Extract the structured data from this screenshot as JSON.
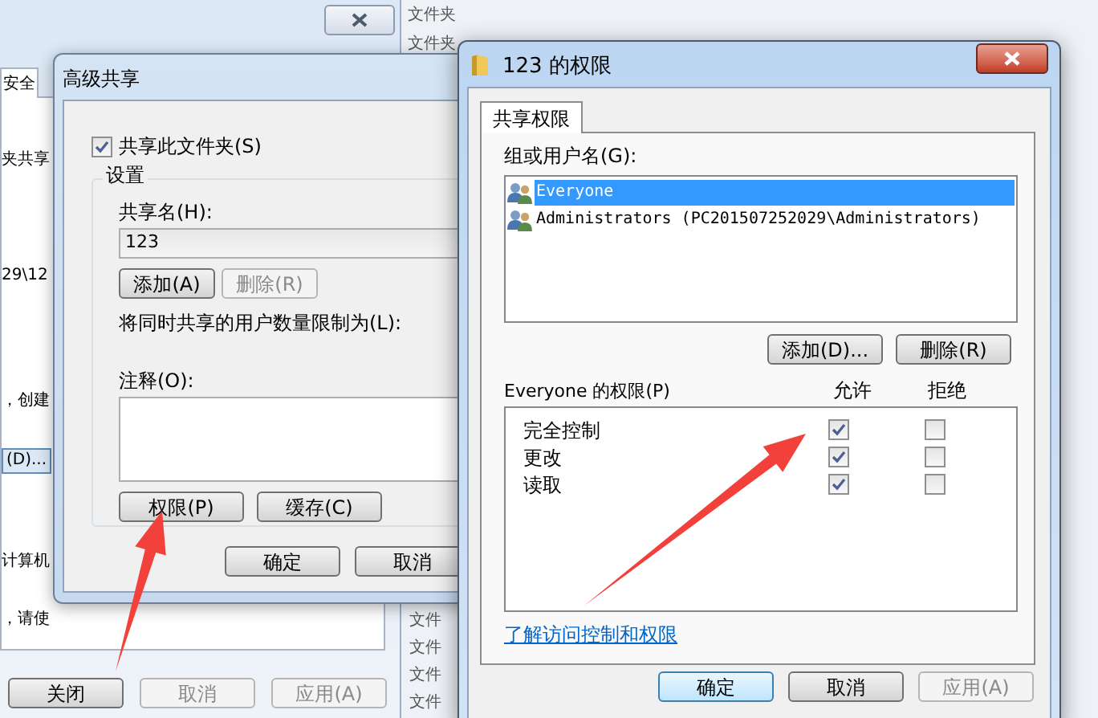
{
  "background_window": {
    "tab": "安全",
    "fragments": [
      {
        "kind": "text",
        "text": "夹共享"
      },
      {
        "kind": "text",
        "text": "29\\12"
      },
      {
        "kind": "text",
        "text": "，创建"
      },
      {
        "kind": "button",
        "text": "(D)..."
      },
      {
        "kind": "text",
        "text": "计算机"
      },
      {
        "kind": "text",
        "text": "，请使"
      }
    ],
    "buttons": [
      {
        "label": "关闭",
        "disabled": false
      },
      {
        "label": "取消",
        "disabled": true
      },
      {
        "label": "应用(A)",
        "disabled": true
      }
    ],
    "side_labels_top": [
      "文件夹",
      "文件夹"
    ],
    "side_labels_bottom": [
      "文件",
      "文件",
      "文件",
      "文件"
    ]
  },
  "advanced_sharing": {
    "title": "高级共享",
    "share_checkbox": {
      "label": "共享此文件夹(S)",
      "checked": true
    },
    "group_title": "设置",
    "share_name_label": "共享名(H):",
    "share_name": "123",
    "add_button": {
      "label": "添加(A)",
      "disabled": false
    },
    "remove_button": {
      "label": "删除(R)",
      "disabled": true
    },
    "limit_label": "将同时共享的用户数量限制为(L):",
    "comment_label": "注释(O):",
    "buttons": [
      {
        "label": "权限(P)"
      },
      {
        "label": "缓存(C)"
      }
    ],
    "footer_buttons": [
      {
        "label": "确定"
      },
      {
        "label": "取消"
      }
    ]
  },
  "permissions_dialog": {
    "title": "123 的权限",
    "tabs": [
      {
        "label": "共享权限",
        "selected": true
      }
    ],
    "users_label": "组或用户名(G):",
    "users": [
      {
        "name": "Everyone",
        "selected": true
      },
      {
        "name": "Administrators (PC201507252029\\Administrators)",
        "selected": false
      }
    ],
    "user_buttons": [
      {
        "label": "添加(D)..."
      },
      {
        "label": "删除(R)"
      }
    ],
    "permissions_label": "Everyone 的权限(P)",
    "allow_header": "允许",
    "deny_header": "拒绝",
    "permissions": [
      {
        "name": "完全控制",
        "allow": true,
        "deny": false
      },
      {
        "name": "更改",
        "allow": true,
        "deny": false
      },
      {
        "name": "读取",
        "allow": true,
        "deny": false
      }
    ],
    "help_link": "了解访问控制和权限",
    "footer_buttons": [
      {
        "label": "确定",
        "default": true,
        "disabled": false
      },
      {
        "label": "取消",
        "default": false,
        "disabled": false
      },
      {
        "label": "应用(A)",
        "default": false,
        "disabled": true
      }
    ]
  }
}
